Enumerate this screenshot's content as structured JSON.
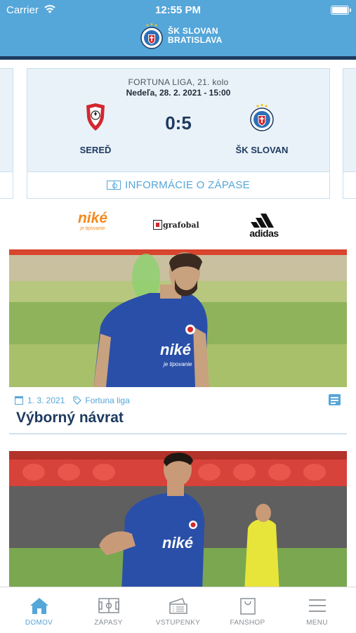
{
  "status_bar": {
    "carrier": "Carrier",
    "time": "12:55 PM"
  },
  "header": {
    "title_line1": "ŠK SLOVAN",
    "title_line2": "BRATISLAVA"
  },
  "match": {
    "competition": "FORTUNA LIGA, 21. kolo",
    "date": "Nedeľa, 28. 2. 2021  - 15:00",
    "home_team": "SEREĎ",
    "away_team": "ŠK SLOVAN",
    "score": "0:5",
    "info_button": "INFORMÁCIE O ZÁPASE"
  },
  "sponsors": {
    "nike_word": "niké",
    "nike_tagline": "je tipovanie",
    "grafobal": "grafobal",
    "adidas": "adidas"
  },
  "articles": [
    {
      "date": "1. 3. 2021",
      "category": "Fortuna liga",
      "title": "Výborný návrat"
    },
    {
      "photo_text": "niké"
    }
  ],
  "article1_shirt_text": "niké",
  "article1_shirt_sub": "je tipovanie",
  "tabs": [
    {
      "label": "DOMOV",
      "icon": "home-icon",
      "active": true
    },
    {
      "label": "ZÁPASY",
      "icon": "pitch-icon",
      "active": false
    },
    {
      "label": "VSTUPENKY",
      "icon": "tickets-icon",
      "active": false
    },
    {
      "label": "FANSHOP",
      "icon": "shopping-bag-icon",
      "active": false
    },
    {
      "label": "MENU",
      "icon": "hamburger-icon",
      "active": false
    }
  ],
  "colors": {
    "header": "#55a6d9",
    "header_line": "#1e3a5f",
    "card_bg": "#eaf2f9",
    "accent": "#55a6d9",
    "dark_text": "#1e3a5f"
  }
}
